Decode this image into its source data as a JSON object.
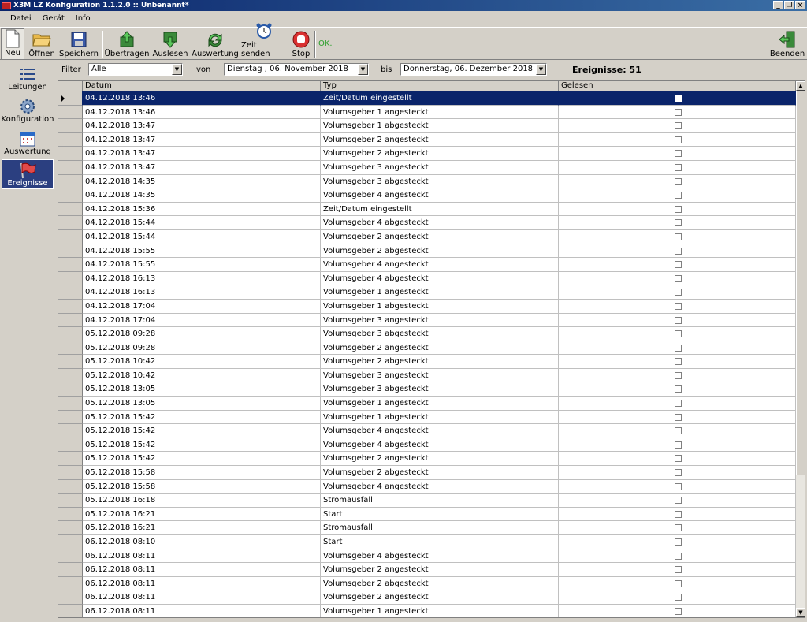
{
  "window": {
    "title": "X3M LZ Konfiguration 1.1.2.0  ::  Unbenannt*",
    "controls": [
      "_",
      "❐",
      "×"
    ]
  },
  "menu": [
    "Datei",
    "Gerät",
    "Info"
  ],
  "toolbar": {
    "new": "Neu",
    "open": "Öffnen",
    "save": "Speichern",
    "transfer": "Übertragen",
    "read": "Auslesen",
    "evaluate": "Auswertung",
    "send_time": "Zeit senden",
    "stop": "Stop",
    "status": "OK.",
    "exit": "Beenden"
  },
  "sidebar": [
    {
      "label": "Leitungen",
      "icon": "list-icon"
    },
    {
      "label": "Konfiguration",
      "icon": "gear-icon"
    },
    {
      "label": "Auswertung",
      "icon": "calendar-icon"
    },
    {
      "label": "Ereignisse",
      "icon": "flag-icon",
      "active": true
    }
  ],
  "filter": {
    "label": "Filter",
    "value": "Alle",
    "from_label": "von",
    "from_value": "Dienstag  , 06. November 2018",
    "to_label": "bis",
    "to_value": "Donnerstag, 06. Dezember 2018",
    "events_count": "Ereignisse: 51"
  },
  "grid": {
    "columns": [
      "Datum",
      "Typ",
      "Gelesen"
    ],
    "selected_index": 0,
    "rows": [
      [
        "04.12.2018 13:46",
        "Zeit/Datum eingestellt"
      ],
      [
        "04.12.2018 13:46",
        "Volumsgeber 1 angesteckt"
      ],
      [
        "04.12.2018 13:47",
        "Volumsgeber 1 abgesteckt"
      ],
      [
        "04.12.2018 13:47",
        "Volumsgeber 2 angesteckt"
      ],
      [
        "04.12.2018 13:47",
        "Volumsgeber 2 abgesteckt"
      ],
      [
        "04.12.2018 13:47",
        "Volumsgeber 3 angesteckt"
      ],
      [
        "04.12.2018 14:35",
        "Volumsgeber 3 abgesteckt"
      ],
      [
        "04.12.2018 14:35",
        "Volumsgeber 4 angesteckt"
      ],
      [
        "04.12.2018 15:36",
        "Zeit/Datum eingestellt"
      ],
      [
        "04.12.2018 15:44",
        "Volumsgeber 4 abgesteckt"
      ],
      [
        "04.12.2018 15:44",
        "Volumsgeber 2 angesteckt"
      ],
      [
        "04.12.2018 15:55",
        "Volumsgeber 2 abgesteckt"
      ],
      [
        "04.12.2018 15:55",
        "Volumsgeber 4 angesteckt"
      ],
      [
        "04.12.2018 16:13",
        "Volumsgeber 4 abgesteckt"
      ],
      [
        "04.12.2018 16:13",
        "Volumsgeber 1 angesteckt"
      ],
      [
        "04.12.2018 17:04",
        "Volumsgeber 1 abgesteckt"
      ],
      [
        "04.12.2018 17:04",
        "Volumsgeber 3 angesteckt"
      ],
      [
        "05.12.2018 09:28",
        "Volumsgeber 3 abgesteckt"
      ],
      [
        "05.12.2018 09:28",
        "Volumsgeber 2 angesteckt"
      ],
      [
        "05.12.2018 10:42",
        "Volumsgeber 2 abgesteckt"
      ],
      [
        "05.12.2018 10:42",
        "Volumsgeber 3 angesteckt"
      ],
      [
        "05.12.2018 13:05",
        "Volumsgeber 3 abgesteckt"
      ],
      [
        "05.12.2018 13:05",
        "Volumsgeber 1 angesteckt"
      ],
      [
        "05.12.2018 15:42",
        "Volumsgeber 1 abgesteckt"
      ],
      [
        "05.12.2018 15:42",
        "Volumsgeber 4 angesteckt"
      ],
      [
        "05.12.2018 15:42",
        "Volumsgeber 4 abgesteckt"
      ],
      [
        "05.12.2018 15:42",
        "Volumsgeber 2 angesteckt"
      ],
      [
        "05.12.2018 15:58",
        "Volumsgeber 2 abgesteckt"
      ],
      [
        "05.12.2018 15:58",
        "Volumsgeber 4 angesteckt"
      ],
      [
        "05.12.2018 16:18",
        "Stromausfall"
      ],
      [
        "05.12.2018 16:21",
        "Start"
      ],
      [
        "05.12.2018 16:21",
        "Stromausfall"
      ],
      [
        "06.12.2018 08:10",
        "Start"
      ],
      [
        "06.12.2018 08:11",
        "Volumsgeber 4 abgesteckt"
      ],
      [
        "06.12.2018 08:11",
        "Volumsgeber 2 angesteckt"
      ],
      [
        "06.12.2018 08:11",
        "Volumsgeber 2 abgesteckt"
      ],
      [
        "06.12.2018 08:11",
        "Volumsgeber 2 angesteckt"
      ],
      [
        "06.12.2018 08:11",
        "Volumsgeber 1 angesteckt"
      ]
    ]
  },
  "scrollbar": {
    "up": "▲",
    "down": "▼"
  },
  "colors": {
    "titlebar": "#0a246a",
    "selection": "#0a246a",
    "status_ok": "#2ca02c",
    "sidebar_active": "#2b3f80"
  }
}
